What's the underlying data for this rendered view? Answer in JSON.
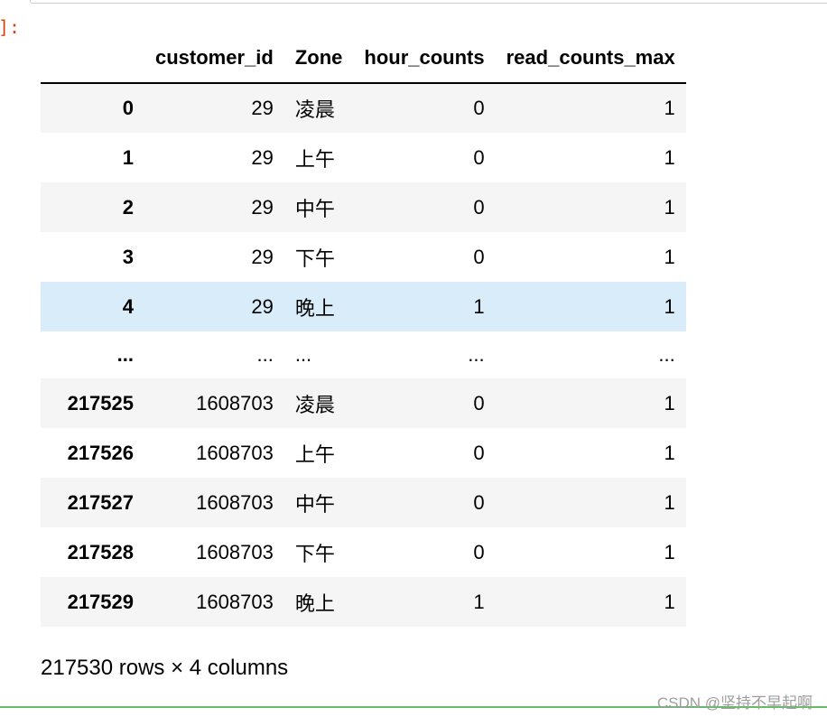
{
  "cell": {
    "prompt": "]:"
  },
  "table": {
    "columns": [
      "customer_id",
      "Zone",
      "hour_counts",
      "read_counts_max"
    ],
    "rows": [
      {
        "index": "0",
        "customer_id": "29",
        "zone": "凌晨",
        "hour_counts": "0",
        "read_counts_max": "1"
      },
      {
        "index": "1",
        "customer_id": "29",
        "zone": "上午",
        "hour_counts": "0",
        "read_counts_max": "1"
      },
      {
        "index": "2",
        "customer_id": "29",
        "zone": "中午",
        "hour_counts": "0",
        "read_counts_max": "1"
      },
      {
        "index": "3",
        "customer_id": "29",
        "zone": "下午",
        "hour_counts": "0",
        "read_counts_max": "1"
      },
      {
        "index": "4",
        "customer_id": "29",
        "zone": "晚上",
        "hour_counts": "1",
        "read_counts_max": "1"
      },
      {
        "index": "...",
        "customer_id": "...",
        "zone": "...",
        "hour_counts": "...",
        "read_counts_max": "..."
      },
      {
        "index": "217525",
        "customer_id": "1608703",
        "zone": "凌晨",
        "hour_counts": "0",
        "read_counts_max": "1"
      },
      {
        "index": "217526",
        "customer_id": "1608703",
        "zone": "上午",
        "hour_counts": "0",
        "read_counts_max": "1"
      },
      {
        "index": "217527",
        "customer_id": "1608703",
        "zone": "中午",
        "hour_counts": "0",
        "read_counts_max": "1"
      },
      {
        "index": "217528",
        "customer_id": "1608703",
        "zone": "下午",
        "hour_counts": "0",
        "read_counts_max": "1"
      },
      {
        "index": "217529",
        "customer_id": "1608703",
        "zone": "晚上",
        "hour_counts": "1",
        "read_counts_max": "1"
      }
    ],
    "hovered_row": 4,
    "ellipsis_row": 5
  },
  "footer": {
    "shape_text": "217530 rows × 4 columns"
  },
  "watermark": {
    "text": "CSDN @坚持不早起啊"
  },
  "colors": {
    "prompt": "#d84315",
    "row_stripe": "#f5f5f5",
    "row_hover": "#d9ecfa",
    "cell_border_bottom": "#66bb6a"
  }
}
